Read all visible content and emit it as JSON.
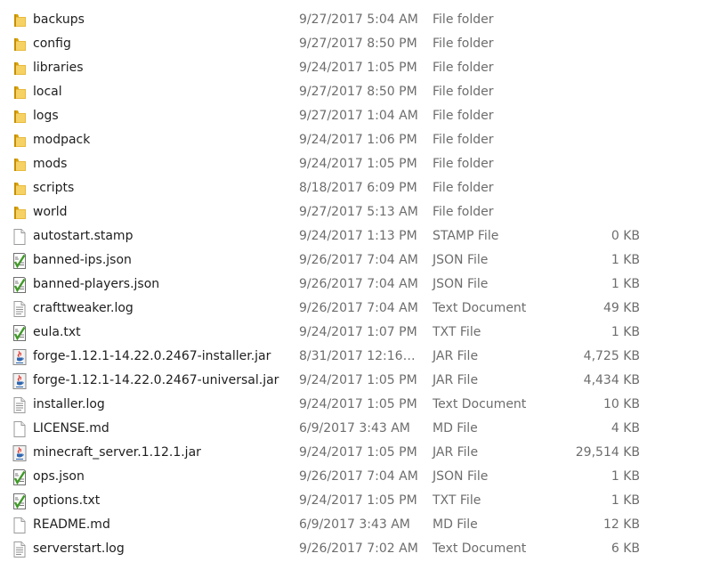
{
  "files": [
    {
      "name": "backups",
      "date": "9/27/2017 5:04 AM",
      "type": "File folder",
      "size": "",
      "icon": "folder-icon"
    },
    {
      "name": "config",
      "date": "9/27/2017 8:50 PM",
      "type": "File folder",
      "size": "",
      "icon": "folder-icon"
    },
    {
      "name": "libraries",
      "date": "9/24/2017 1:05 PM",
      "type": "File folder",
      "size": "",
      "icon": "folder-icon"
    },
    {
      "name": "local",
      "date": "9/27/2017 8:50 PM",
      "type": "File folder",
      "size": "",
      "icon": "folder-icon"
    },
    {
      "name": "logs",
      "date": "9/27/2017 1:04 AM",
      "type": "File folder",
      "size": "",
      "icon": "folder-icon"
    },
    {
      "name": "modpack",
      "date": "9/24/2017 1:06 PM",
      "type": "File folder",
      "size": "",
      "icon": "folder-icon"
    },
    {
      "name": "mods",
      "date": "9/24/2017 1:05 PM",
      "type": "File folder",
      "size": "",
      "icon": "folder-icon"
    },
    {
      "name": "scripts",
      "date": "8/18/2017 6:09 PM",
      "type": "File folder",
      "size": "",
      "icon": "folder-icon"
    },
    {
      "name": "world",
      "date": "9/27/2017 5:13 AM",
      "type": "File folder",
      "size": "",
      "icon": "folder-icon"
    },
    {
      "name": "autostart.stamp",
      "date": "9/24/2017 1:13 PM",
      "type": "STAMP File",
      "size": "0 KB",
      "icon": "blank-file-icon"
    },
    {
      "name": "banned-ips.json",
      "date": "9/26/2017 7:04 AM",
      "type": "JSON File",
      "size": "1 KB",
      "icon": "editable-file-icon"
    },
    {
      "name": "banned-players.json",
      "date": "9/26/2017 7:04 AM",
      "type": "JSON File",
      "size": "1 KB",
      "icon": "editable-file-icon"
    },
    {
      "name": "crafttweaker.log",
      "date": "9/26/2017 7:04 AM",
      "type": "Text Document",
      "size": "49 KB",
      "icon": "text-file-icon"
    },
    {
      "name": "eula.txt",
      "date": "9/24/2017 1:07 PM",
      "type": "TXT File",
      "size": "1 KB",
      "icon": "editable-file-icon"
    },
    {
      "name": "forge-1.12.1-14.22.0.2467-installer.jar",
      "date": "8/31/2017 12:16 A...",
      "type": "JAR File",
      "size": "4,725 KB",
      "icon": "java-jar-icon"
    },
    {
      "name": "forge-1.12.1-14.22.0.2467-universal.jar",
      "date": "9/24/2017 1:05 PM",
      "type": "JAR File",
      "size": "4,434 KB",
      "icon": "java-jar-icon"
    },
    {
      "name": "installer.log",
      "date": "9/24/2017 1:05 PM",
      "type": "Text Document",
      "size": "10 KB",
      "icon": "text-file-icon"
    },
    {
      "name": "LICENSE.md",
      "date": "6/9/2017 3:43 AM",
      "type": "MD File",
      "size": "4 KB",
      "icon": "blank-file-icon"
    },
    {
      "name": "minecraft_server.1.12.1.jar",
      "date": "9/24/2017 1:05 PM",
      "type": "JAR File",
      "size": "29,514 KB",
      "icon": "java-jar-icon"
    },
    {
      "name": "ops.json",
      "date": "9/26/2017 7:04 AM",
      "type": "JSON File",
      "size": "1 KB",
      "icon": "editable-file-icon"
    },
    {
      "name": "options.txt",
      "date": "9/24/2017 1:05 PM",
      "type": "TXT File",
      "size": "1 KB",
      "icon": "editable-file-icon"
    },
    {
      "name": "README.md",
      "date": "6/9/2017 3:43 AM",
      "type": "MD File",
      "size": "12 KB",
      "icon": "blank-file-icon"
    },
    {
      "name": "serverstart.log",
      "date": "9/26/2017 7:02 AM",
      "type": "Text Document",
      "size": "6 KB",
      "icon": "text-file-icon"
    }
  ]
}
